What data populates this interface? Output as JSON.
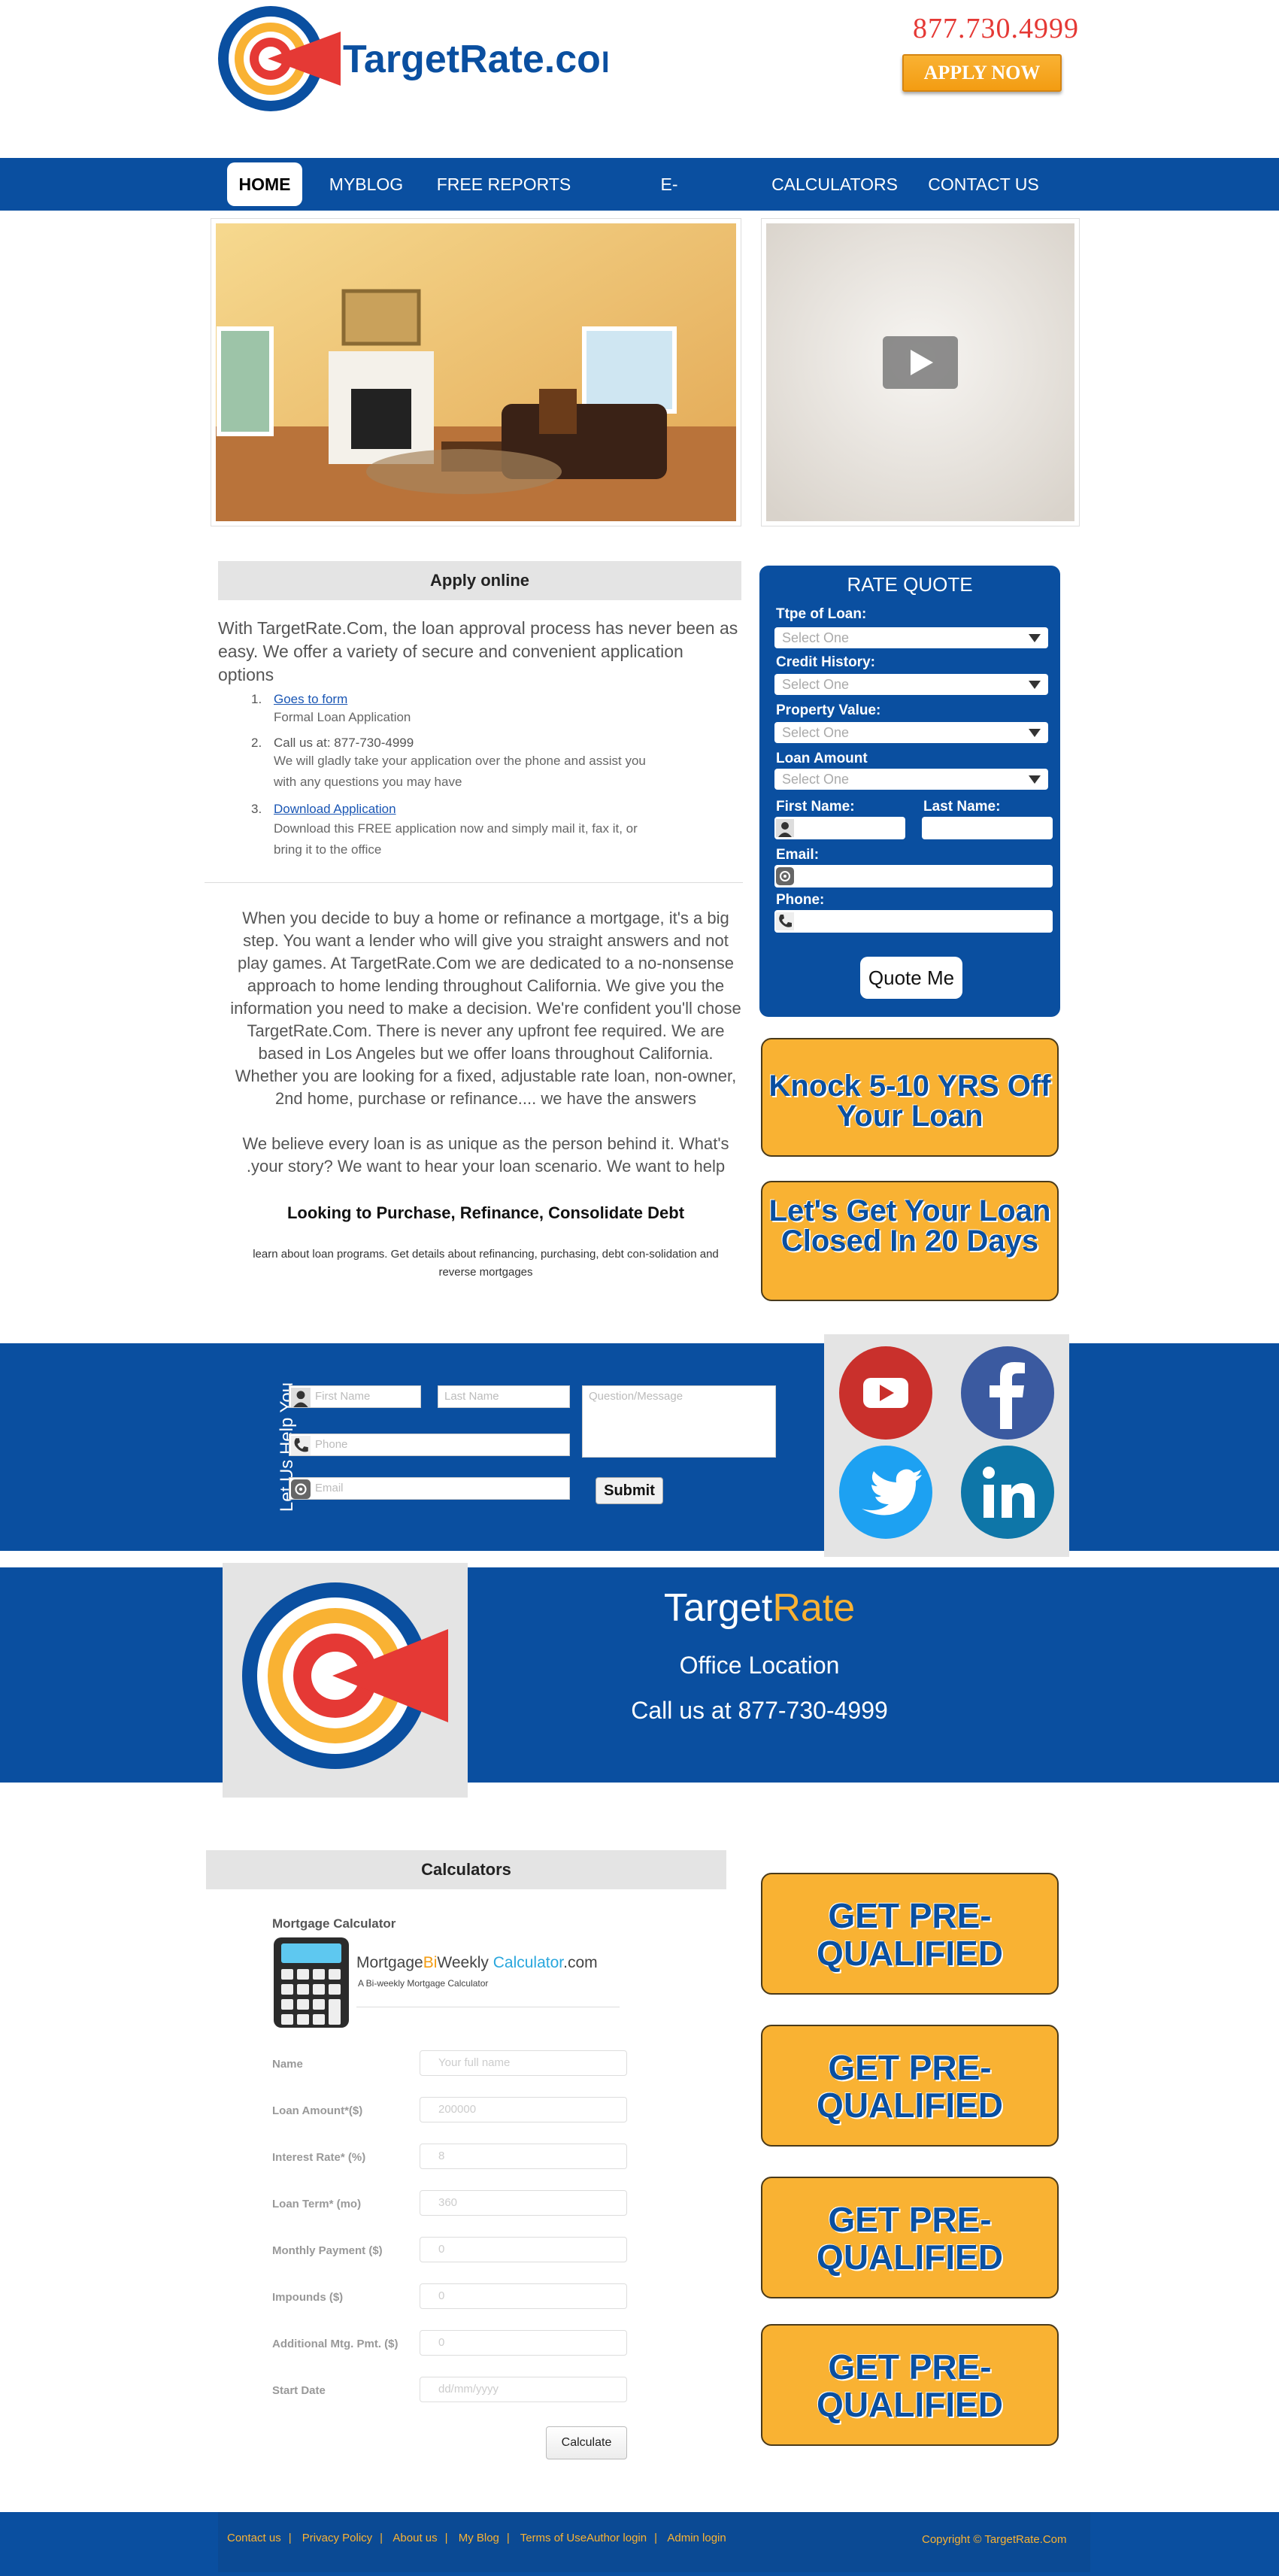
{
  "header": {
    "brand": "TargetRate.com",
    "phone": "877.730.4999",
    "apply_now": "APPLY NOW"
  },
  "nav": {
    "items": [
      "HOME",
      "MYBLOG",
      "FREE REPORTS",
      "E-NEWSLETTER",
      "CALCULATORS",
      "CONTACT US"
    ],
    "active": "HOME"
  },
  "apply": {
    "heading": "Apply online",
    "intro": "With TargetRate.Com, the loan approval process has never been as easy. We offer a variety of secure and convenient application options",
    "options": [
      {
        "num": "1.",
        "title": "Goes to form",
        "desc": "Formal Loan Application"
      },
      {
        "num": "2.",
        "title": "Call us at:  877-730-4999",
        "desc": "We will gladly take your application over the phone and assist you with any questions you may have"
      },
      {
        "num": "3.",
        "title": "Download Application",
        "desc": "Download this FREE application now and simply mail it, fax it, or bring it to the office"
      }
    ]
  },
  "about": {
    "paragraph1": "When you decide to buy a home or refinance a mortgage, it's a big step. You want a lender who will give you straight answers and not play games. At TargetRate.Com we are dedicated to a no-nonsense approach to home lending throughout California. We give you the information you need to make a decision. We're confident you'll chose TargetRate.Com.  There is never any upfront fee required. We are based in Los Angeles but we offer loans throughout California. Whether you are looking for a fixed, adjustable rate loan, non-owner, 2nd home, purchase or refinance.... we have the answers",
    "paragraph2": "We believe every loan is as unique as the person behind it. What's .your story? We want to hear your loan scenario.  We want to help",
    "looking": "Looking to Purchase, Refinance, Consolidate Debt",
    "learn": "learn about loan programs. Get details about refinancing, purchasing, debt con-solidation and reverse mortgages"
  },
  "rate_quote": {
    "title": "RATE QUOTE",
    "type_label": "Ttpe of Loan:",
    "credit_label": "Credit History:",
    "property_label": "Property Value:",
    "amount_label": "Loan Amount",
    "select_placeholder": "Select One",
    "first_name_label": "First Name:",
    "last_name_label": "Last Name:",
    "email_label": "Email:",
    "phone_label": "Phone:",
    "button": "Quote Me"
  },
  "promos": {
    "knock": "Knock 5-10 YRS Off Your Loan",
    "closed": "Let's Get Your Loan Closed In 20 Days",
    "prequal": "GET PRE-QUALIFIED"
  },
  "help": {
    "title": "Let Us Help You",
    "first_name": "First Name",
    "last_name": "Last Name",
    "message": "Question/Message",
    "phone": "Phone",
    "email": "Email",
    "submit": "Submit"
  },
  "office": {
    "brand_part1": "Target",
    "brand_part2": "Rate",
    "location": "Office Location",
    "call": "Call us at   877-730-4999"
  },
  "calculator": {
    "heading": "Calculators",
    "title": "Mortgage Calculator",
    "brand_a": "Mortgage",
    "brand_b": "Bi",
    "brand_c": "Weekly ",
    "brand_d": "Calculator",
    "brand_e": ".com",
    "subtitle": "A Bi-weekly Mortgage Calculator",
    "fields": [
      {
        "label": "Name",
        "placeholder": "Your full name"
      },
      {
        "label": "Loan Amount*($)",
        "placeholder": "200000"
      },
      {
        "label": "Interest Rate* (%)",
        "placeholder": "8"
      },
      {
        "label": "Loan Term* (mo)",
        "placeholder": "360"
      },
      {
        "label": "Monthly Payment ($)",
        "placeholder": "0"
      },
      {
        "label": "Impounds ($)",
        "placeholder": "0"
      },
      {
        "label": "Additional Mtg. Pmt. ($)",
        "placeholder": "0"
      },
      {
        "label": "Start Date",
        "placeholder": "dd/mm/yyyy"
      }
    ],
    "button": "Calculate"
  },
  "footer": {
    "links": [
      "Contact us",
      "Privacy Policy",
      "About us",
      "My Blog",
      "Terms of UseAuthor login",
      "Admin login"
    ],
    "copyright": "Copyright © TargetRate.Com"
  },
  "colors": {
    "brand_blue": "#0a4fa0",
    "accent_orange": "#f9b233",
    "logo_red": "#e53935"
  }
}
